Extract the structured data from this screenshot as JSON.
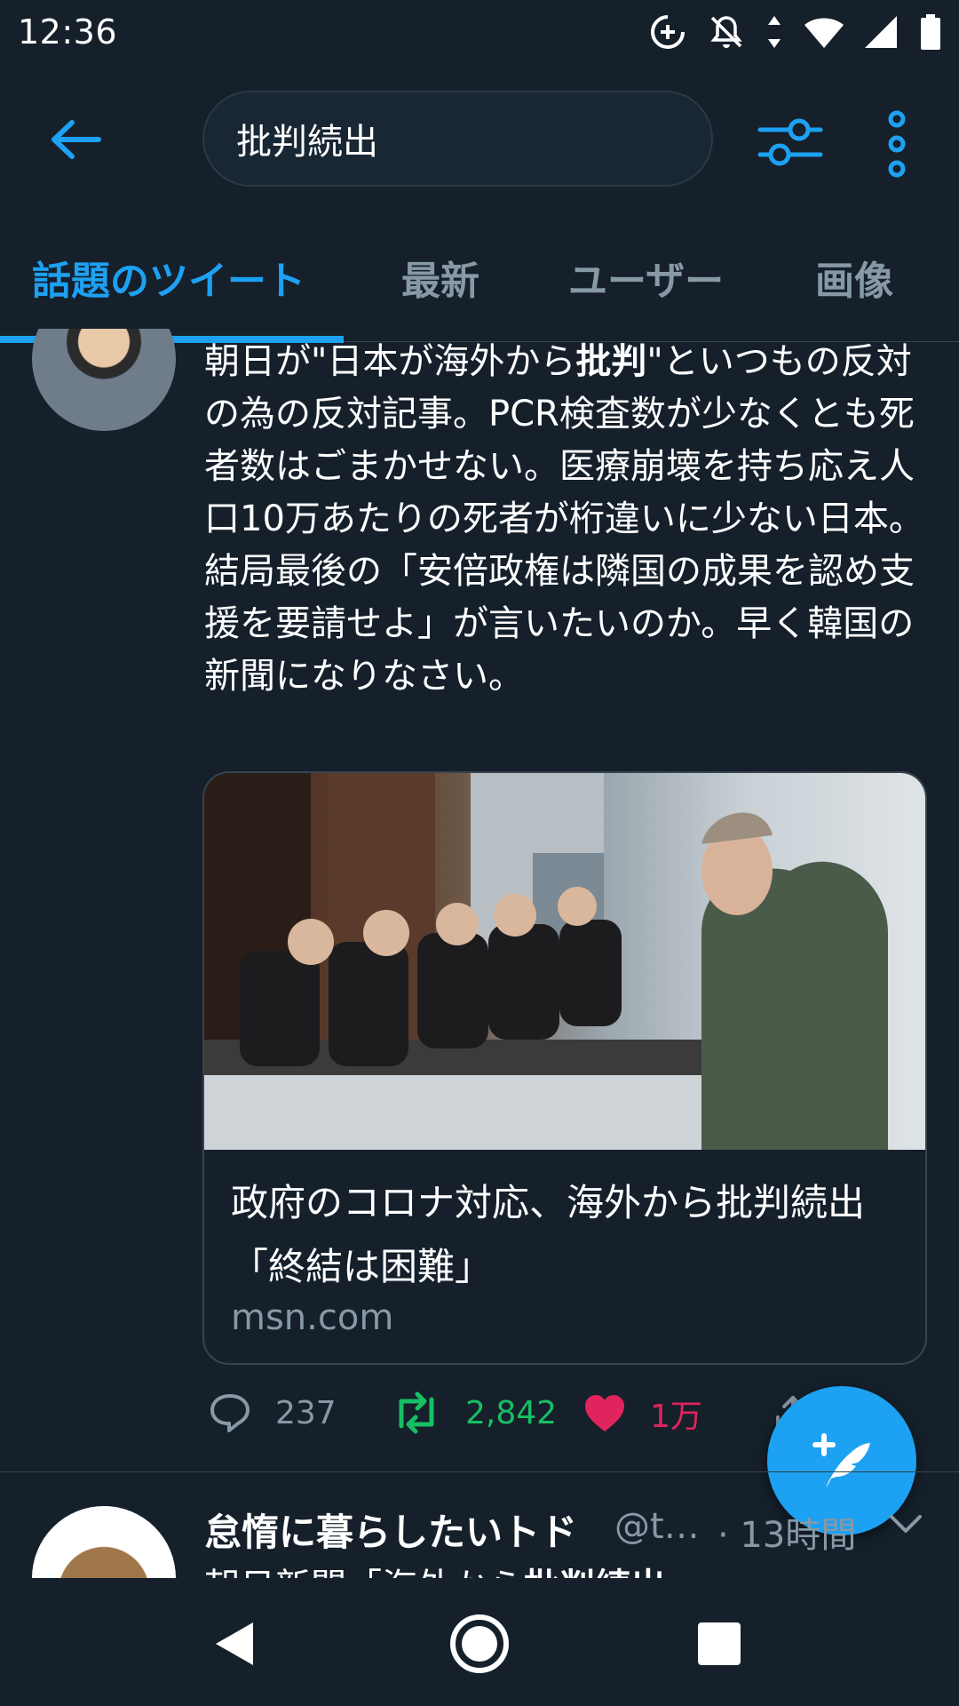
{
  "status_bar": {
    "time": "12:36"
  },
  "search": {
    "query": "批判続出"
  },
  "tabs": [
    {
      "label": "話題のツイート",
      "active": true
    },
    {
      "label": "最新",
      "active": false
    },
    {
      "label": "ユーザー",
      "active": false
    },
    {
      "label": "画像",
      "active": false
    }
  ],
  "tweet1": {
    "text_before": "朝日が\"日本が海外から",
    "text_highlight": "批判",
    "text_after": "\"といつもの反対の為の反対記事。PCR検査数が少なくとも死者数はごまかせない。医療崩壊を持ち応え人口10万あたりの死者が桁違いに少ない日本。結局最後の「安倍政権は隣国の成果を認め支援を要請せよ」が言いたいのか。早く韓国の新聞になりなさい。",
    "card": {
      "title": "政府のコロナ対応、海外から批判続出「終結は困難」",
      "domain": "msn.com"
    },
    "actions": {
      "replies": "237",
      "retweets": "2,842",
      "likes": "1万"
    }
  },
  "tweet2": {
    "name": "怠惰に暮らしたいトド",
    "handle": "@t…",
    "time": "· 13時間",
    "text_before": "朝日新聞「海外から",
    "text_highlight": "批判続出",
    "text_after": "」"
  },
  "colors": {
    "background": "#15202b",
    "accent": "#1da1f2",
    "retweet": "#17bf63",
    "like": "#e0245e",
    "secondary_text": "#8899a6"
  }
}
